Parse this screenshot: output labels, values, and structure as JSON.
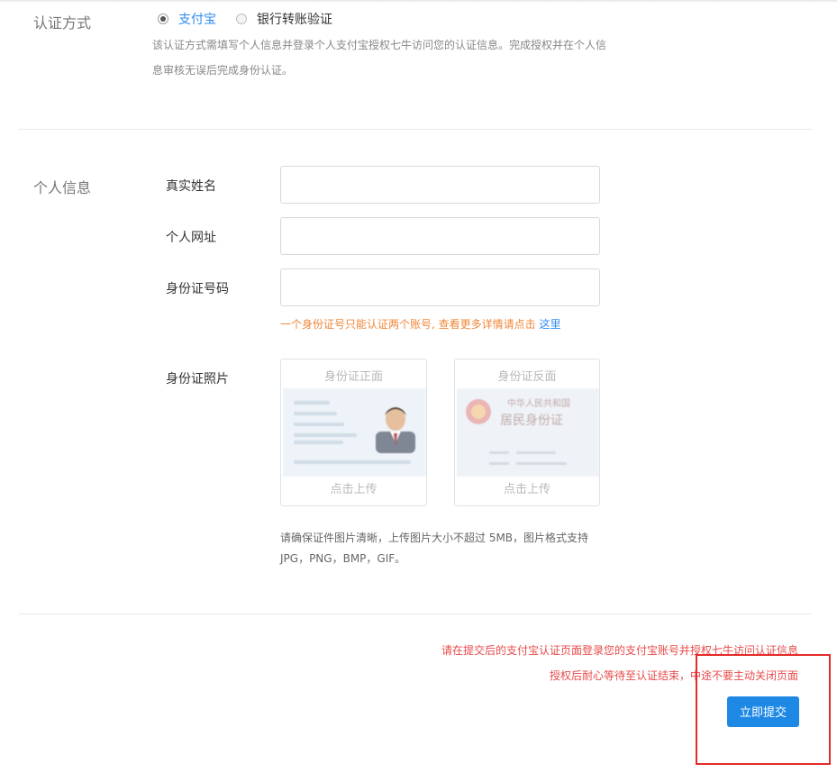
{
  "verify_method": {
    "label": "认证方式",
    "options": [
      {
        "label": "支付宝",
        "selected": true
      },
      {
        "label": "银行转账验证",
        "selected": false
      }
    ],
    "description_line1": "该认证方式需填写个人信息并登录个人支付宝授权七牛访问您的认证信息。完成授权并在个人信",
    "description_line2": "息审核无误后完成身份认证。"
  },
  "personal_info": {
    "label": "个人信息",
    "fields": [
      {
        "label": "真实姓名",
        "value": ""
      },
      {
        "label": "个人网址",
        "value": ""
      },
      {
        "label": "身份证号码",
        "value": ""
      }
    ],
    "id_hint": "一个身份证号只能认证两个账号, 查看更多详情请点击",
    "id_hint_link": "这里",
    "photo_label": "身份证照片",
    "front_card": {
      "title": "身份证正面",
      "upload": "点击上传"
    },
    "back_card": {
      "title": "身份证反面",
      "upload": "点击上传",
      "heading1": "中华人民共和国",
      "heading2": "居民身份证"
    },
    "photo_note_line1": "请确保证件图片清晰，上传图片大小不超过 5MB，图片格式支持",
    "photo_note_line2": "JPG，PNG，BMP，GIF。"
  },
  "footer": {
    "warning_line1": "请在提交后的支付宝认证页面登录您的支付宝账号并授权七牛访问认证信息",
    "warning_line2": "授权后耐心等待至认证结束，中途不要主动关闭页面",
    "submit_label": "立即提交"
  },
  "colors": {
    "accent": "#1e88e5",
    "warning": "#e84a4a",
    "hint": "#f0883a",
    "highlight_box": "#e52b2b"
  }
}
